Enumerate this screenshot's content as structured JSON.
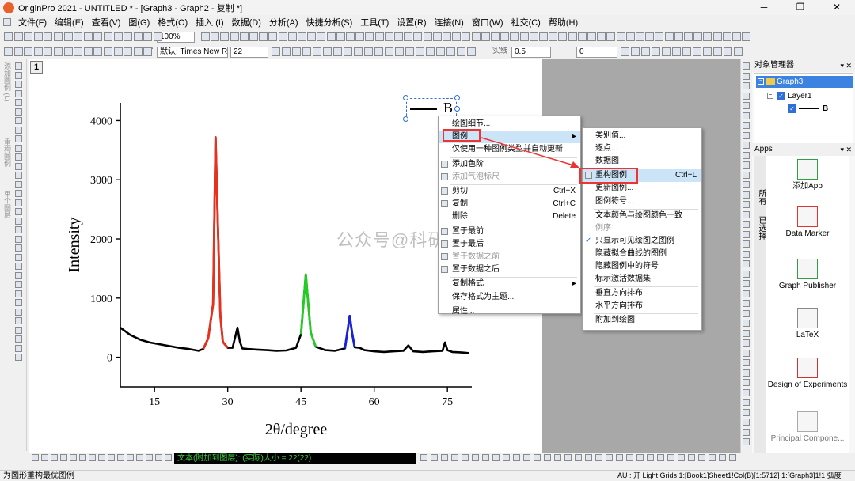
{
  "app": {
    "title": "OriginPro 2021 - UNTITLED * - [Graph3 - Graph2 - 复制 *]",
    "window_controls": [
      "─",
      "❐",
      "✕"
    ]
  },
  "menu": [
    "文件(F)",
    "编辑(E)",
    "查看(V)",
    "图(G)",
    "格式(O)",
    "插入 (I)",
    "数据(D)",
    "分析(A)",
    "快捷分析(S)",
    "工具(T)",
    "设置(R)",
    "连接(N)",
    "窗口(W)",
    "社交(C)",
    "帮助(H)"
  ],
  "toolbar": {
    "zoom": "100%",
    "font_name": "默认: Times New R",
    "font_size": "22",
    "line_style": "实线",
    "line_width": "0.5",
    "pattern_value": "0"
  },
  "left_vertical_labels": [
    "添加图例 (L)",
    "重构图例",
    "单个图层"
  ],
  "page": {
    "number": "1"
  },
  "chart_data": {
    "type": "line",
    "xlabel": "2θ/degree",
    "ylabel": "Intensity",
    "xlim": [
      8,
      80
    ],
    "ylim": [
      -500,
      4300
    ],
    "xticks": [
      "15",
      "30",
      "45",
      "60",
      "75"
    ],
    "yticks": [
      "0",
      "1000",
      "2000",
      "3000",
      "4000"
    ],
    "legend": {
      "label": "B",
      "position": "top-right"
    },
    "series": [
      {
        "name": "B",
        "color": "#000000",
        "highlight_ranges": [
          {
            "from": 25.2,
            "to": 29.8,
            "color": "#e8301c"
          },
          {
            "from": 45.5,
            "to": 48.2,
            "color": "#22cc22"
          },
          {
            "from": 54.2,
            "to": 56.2,
            "color": "#1a22d6"
          }
        ],
        "x": [
          8,
          10,
          12,
          14,
          16,
          18,
          20,
          22,
          24,
          25,
          26,
          27,
          27.5,
          28,
          28.5,
          29,
          30,
          31,
          32,
          32.5,
          33,
          34,
          36,
          38,
          40,
          42,
          44,
          45,
          46,
          46.5,
          47,
          48,
          50,
          52,
          54,
          55,
          55.5,
          56,
          57,
          58,
          60,
          62,
          64,
          66,
          67,
          68,
          70,
          72,
          74,
          74.5,
          75,
          76,
          78,
          79.5
        ],
        "y": [
          500,
          380,
          300,
          250,
          220,
          190,
          160,
          140,
          110,
          140,
          320,
          900,
          3720,
          2200,
          700,
          260,
          160,
          160,
          500,
          260,
          150,
          140,
          130,
          120,
          110,
          115,
          160,
          390,
          1400,
          900,
          420,
          180,
          120,
          110,
          150,
          700,
          400,
          170,
          160,
          120,
          100,
          90,
          100,
          110,
          200,
          100,
          90,
          100,
          110,
          250,
          120,
          90,
          80,
          70
        ]
      }
    ]
  },
  "context_menu": {
    "items": [
      {
        "label": "绘图细节...",
        "shortcut": "",
        "disabled": false
      },
      {
        "label": "图例",
        "shortcut": "",
        "disabled": false,
        "submenu": true
      },
      {
        "label": "仅使用一种图例类型并自动更新",
        "shortcut": "",
        "disabled": false
      },
      {
        "label": "添加色阶",
        "shortcut": "",
        "disabled": false
      },
      {
        "label": "添加气泡标尺",
        "shortcut": "",
        "disabled": true
      },
      {
        "label": "剪切",
        "shortcut": "Ctrl+X",
        "disabled": false
      },
      {
        "label": "复制",
        "shortcut": "Ctrl+C",
        "disabled": false
      },
      {
        "label": "删除",
        "shortcut": "Delete",
        "disabled": false
      },
      {
        "label": "置于最前",
        "shortcut": "",
        "disabled": false
      },
      {
        "label": "置于最后",
        "shortcut": "",
        "disabled": false
      },
      {
        "label": "置于数据之前",
        "shortcut": "",
        "disabled": true
      },
      {
        "label": "置于数据之后",
        "shortcut": "",
        "disabled": false
      },
      {
        "label": "复制格式",
        "shortcut": "",
        "disabled": false,
        "submenu": true
      },
      {
        "label": "保存格式为主题...",
        "shortcut": "",
        "disabled": false
      },
      {
        "label": "属性...",
        "shortcut": "",
        "disabled": false
      }
    ]
  },
  "submenu": {
    "items": [
      {
        "label": "类别值...",
        "shortcut": ""
      },
      {
        "label": "逐点...",
        "shortcut": ""
      },
      {
        "label": "数据图",
        "shortcut": ""
      },
      {
        "label": "重构图例",
        "shortcut": "Ctrl+L"
      },
      {
        "label": "更新图例...",
        "shortcut": ""
      },
      {
        "label": "图例符号...",
        "shortcut": ""
      },
      {
        "label": "文本颜色与绘图颜色一致",
        "shortcut": ""
      },
      {
        "label": "例序",
        "shortcut": ""
      },
      {
        "label": "只显示可见绘图之图例",
        "shortcut": "",
        "checked": true
      },
      {
        "label": "隐藏拟合曲线的图例",
        "shortcut": ""
      },
      {
        "label": "隐藏图例中的符号",
        "shortcut": ""
      },
      {
        "label": "标示激活数据集",
        "shortcut": ""
      },
      {
        "label": "垂直方向排布",
        "shortcut": ""
      },
      {
        "label": "水平方向排布",
        "shortcut": ""
      },
      {
        "label": "附加到绘图",
        "shortcut": ""
      }
    ]
  },
  "watermark": "公众号@科研宝典",
  "object_manager": {
    "title": "对象管理器",
    "tree": [
      "Graph3",
      "Layer1",
      "B"
    ]
  },
  "apps": {
    "title": "Apps",
    "side_tabs": [
      "所有",
      "已选择"
    ],
    "items": [
      "添加App",
      "Data Marker",
      "Graph Publisher",
      "LaTeX",
      "Design of Experiments",
      "Principal Compone..."
    ]
  },
  "bottom_status_text": "文本(附加到图层): (实际)大小 = 22(22)",
  "status": {
    "left": "为图形重构最优图例",
    "right": "AU : 开 Light Grids 1:[Book1]Sheet1!Col(B)[1:5712] 1:[Graph3]1!1 弧度"
  }
}
